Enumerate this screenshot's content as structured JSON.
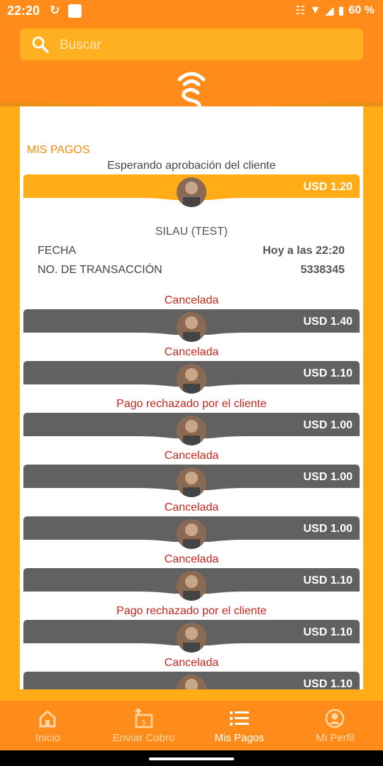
{
  "statusbar": {
    "time": "22:20",
    "battery": "60 %"
  },
  "search": {
    "placeholder": "Buscar"
  },
  "section_title": "MIS PAGOS",
  "colors": {
    "accent": "#FF8C1A",
    "bar_pending": "#FFAC17",
    "bar_done": "#616161",
    "cancel_text": "#C4271B"
  },
  "payments": [
    {
      "status": "Esperando aprobación del cliente",
      "amount": "USD 1.20",
      "state": "pending"
    },
    {
      "status": "Cancelada",
      "amount": "USD 1.40",
      "state": "done"
    },
    {
      "status": "Cancelada",
      "amount": "USD 1.10",
      "state": "done"
    },
    {
      "status": "Pago rechazado por el cliente",
      "amount": "USD 1.00",
      "state": "done"
    },
    {
      "status": "Cancelada",
      "amount": "USD 1.00",
      "state": "done"
    },
    {
      "status": "Cancelada",
      "amount": "USD 1.00",
      "state": "done"
    },
    {
      "status": "Cancelada",
      "amount": "USD 1.10",
      "state": "done"
    },
    {
      "status": "Pago rechazado por el cliente",
      "amount": "USD 1.10",
      "state": "done"
    },
    {
      "status": "Cancelada",
      "amount": "USD 1.10",
      "state": "done"
    }
  ],
  "details": {
    "name": "SILAU (TEST)",
    "date_label": "FECHA",
    "date_value": "Hoy a las 22:20",
    "tx_label": "NO. DE TRANSACCIÓN",
    "tx_value": "5338345"
  },
  "nav": [
    {
      "label": "Inicio",
      "icon": "home-icon"
    },
    {
      "label": "Enviar Cobro",
      "icon": "invoice-icon"
    },
    {
      "label": "Mis Pagos",
      "icon": "list-icon"
    },
    {
      "label": "Mi Perfil",
      "icon": "profile-icon"
    }
  ]
}
